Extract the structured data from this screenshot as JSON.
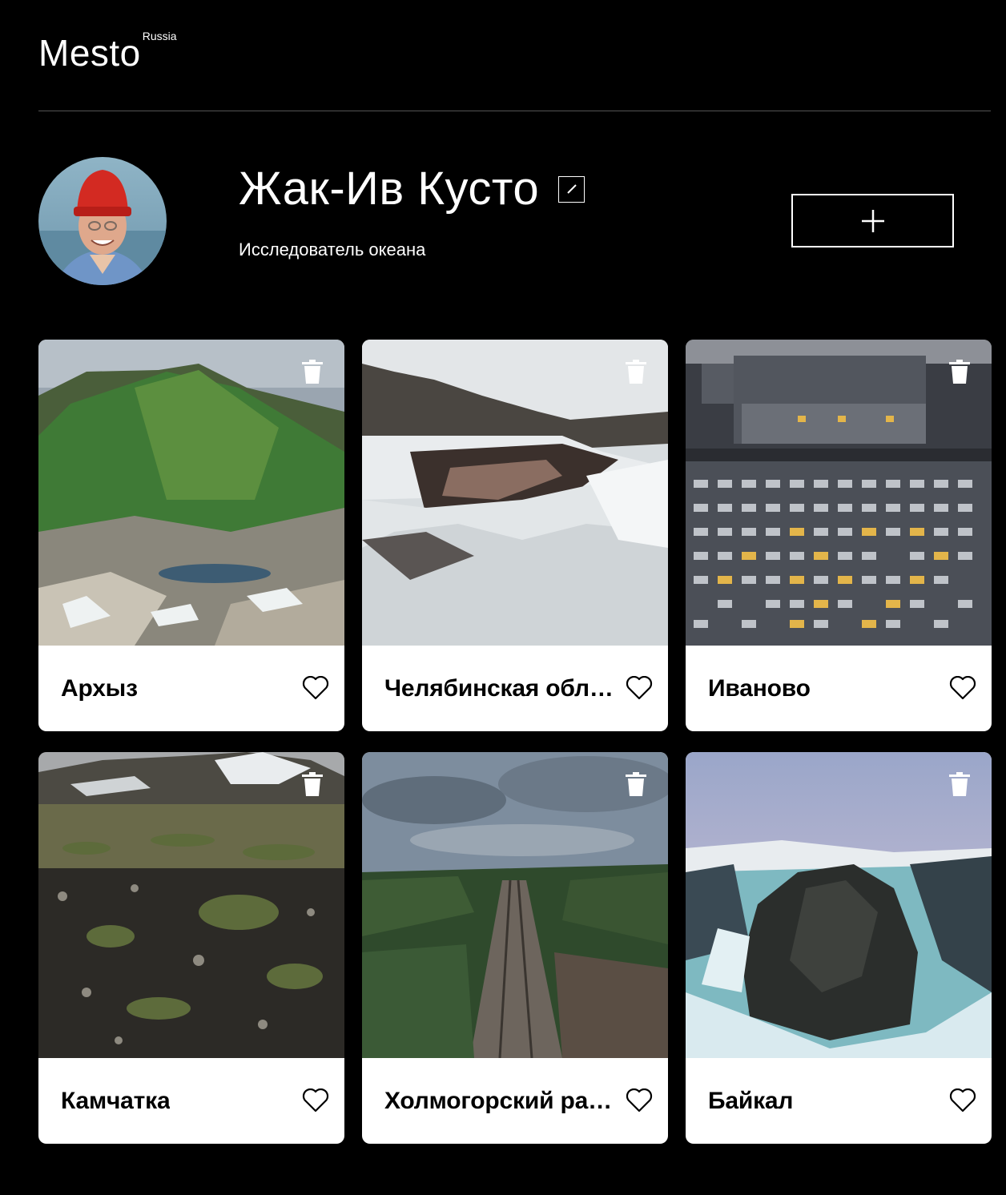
{
  "header": {
    "logo": "Mesto",
    "logo_sup": "Russia"
  },
  "profile": {
    "name": "Жак-Ив Кусто",
    "about": "Исследователь океана",
    "avatar_icon": "avatar-photo",
    "edit_icon": "pencil-icon",
    "add_icon": "plus-icon"
  },
  "cards": [
    {
      "title": "Архыз",
      "scene": "mountains",
      "colors": [
        "#3f6a3a",
        "#6e8f5c",
        "#9aa5b0"
      ]
    },
    {
      "title": "Челябинская область",
      "scene": "river-snow",
      "colors": [
        "#2b2a2a",
        "#d8dde0",
        "#8a6d61"
      ]
    },
    {
      "title": "Иваново",
      "scene": "apartment-blocks",
      "colors": [
        "#3a3d44",
        "#575b63",
        "#e3b54a"
      ]
    },
    {
      "title": "Камчатка",
      "scene": "tundra",
      "colors": [
        "#2c2a26",
        "#5d6b3b",
        "#8e8a80"
      ]
    },
    {
      "title": "Холмогорский район",
      "scene": "railway-forest",
      "colors": [
        "#2f4a2c",
        "#7d8d9e",
        "#6d655d"
      ]
    },
    {
      "title": "Байкал",
      "scene": "cliff-ice",
      "colors": [
        "#2b2e2c",
        "#7eb9c1",
        "#b9a2c6"
      ]
    }
  ],
  "accent_colors": {
    "background": "#000000",
    "divider": "#545454",
    "card": "#ffffff"
  }
}
